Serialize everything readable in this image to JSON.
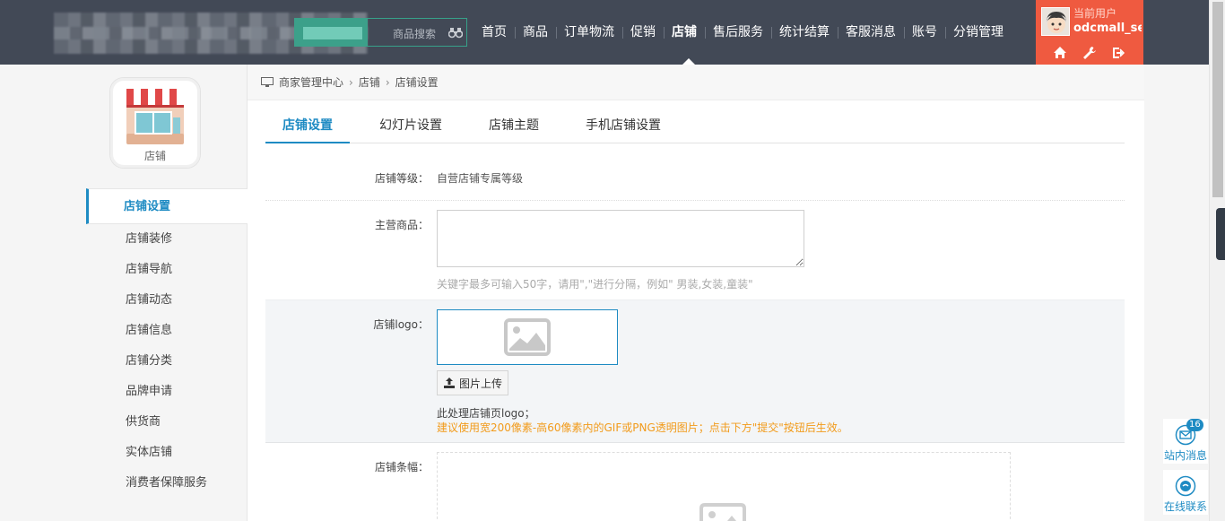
{
  "header": {
    "search_label": "商品搜索",
    "nav": [
      "首页",
      "商品",
      "订单物流",
      "促销",
      "店铺",
      "售后服务",
      "统计结算",
      "客服消息",
      "账号",
      "分销管理"
    ],
    "active_nav": "店铺",
    "user": {
      "role": "当前用户",
      "name": "odcmall_se..."
    }
  },
  "sidebar": {
    "app_label": "店铺",
    "items": [
      "店铺设置",
      "店铺装修",
      "店铺导航",
      "店铺动态",
      "店铺信息",
      "店铺分类",
      "品牌申请",
      "供货商",
      "实体店铺",
      "消费者保障服务"
    ],
    "active": "店铺设置"
  },
  "breadcrumb": [
    "商家管理中心",
    "店铺",
    "店铺设置"
  ],
  "tabs": [
    "店铺设置",
    "幻灯片设置",
    "店铺主题",
    "手机店铺设置"
  ],
  "form": {
    "level": {
      "label": "店铺等级：",
      "value": "自营店铺专属等级"
    },
    "main_goods": {
      "label": "主营商品：",
      "value": "",
      "hint": "关键字最多可输入50字，请用\",\"进行分隔，例如\" 男装,女装,童装\""
    },
    "logo": {
      "label": "店铺logo：",
      "upload": "图片上传",
      "note1": "此处理店铺页logo；",
      "note2": "建议使用宽200像素-高60像素内的GIF或PNG透明图片；点击下方\"提交\"按钮后生效。"
    },
    "banner": {
      "label": "店铺条幅："
    }
  },
  "float": {
    "message": {
      "label": "站内消息",
      "count": "16"
    },
    "chat": {
      "label": "在线联系"
    }
  },
  "colors": {
    "header_bg": "#424956",
    "accent": "#1e8bc3",
    "user_bg": "#ef5a40",
    "warning": "#f29b1b"
  }
}
